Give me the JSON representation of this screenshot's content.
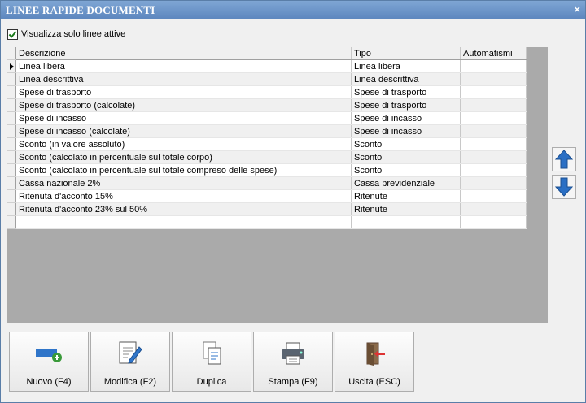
{
  "window": {
    "title": "LINEE RAPIDE DOCUMENTI",
    "close_label": "×"
  },
  "filter": {
    "checkbox_label": "Visualizza solo linee attive",
    "checked": true
  },
  "grid": {
    "columns": [
      "Descrizione",
      "Tipo",
      "Automatismi"
    ],
    "rows": [
      {
        "descrizione": "Linea libera",
        "tipo": "Linea libera",
        "automatismi": ""
      },
      {
        "descrizione": "Linea descrittiva",
        "tipo": "Linea descrittiva",
        "automatismi": ""
      },
      {
        "descrizione": "Spese di trasporto",
        "tipo": "Spese di trasporto",
        "automatismi": ""
      },
      {
        "descrizione": "Spese di trasporto (calcolate)",
        "tipo": "Spese di trasporto",
        "automatismi": ""
      },
      {
        "descrizione": "Spese di incasso",
        "tipo": "Spese di incasso",
        "automatismi": ""
      },
      {
        "descrizione": "Spese di incasso (calcolate)",
        "tipo": "Spese di incasso",
        "automatismi": ""
      },
      {
        "descrizione": "Sconto (in valore assoluto)",
        "tipo": "Sconto",
        "automatismi": ""
      },
      {
        "descrizione": "Sconto (calcolato in percentuale sul totale corpo)",
        "tipo": "Sconto",
        "automatismi": ""
      },
      {
        "descrizione": "Sconto (calcolato in percentuale sul totale compreso delle spese)",
        "tipo": "Sconto",
        "automatismi": ""
      },
      {
        "descrizione": "Cassa nazionale 2%",
        "tipo": "Cassa previdenziale",
        "automatismi": ""
      },
      {
        "descrizione": "Ritenuta d'acconto 15%",
        "tipo": "Ritenute",
        "automatismi": ""
      },
      {
        "descrizione": "Ritenuta d'acconto 23% sul 50%",
        "tipo": "Ritenute",
        "automatismi": ""
      },
      {
        "descrizione": "",
        "tipo": "",
        "automatismi": ""
      }
    ]
  },
  "side": {
    "up_icon": "arrow-up-icon",
    "down_icon": "arrow-down-icon",
    "color": "#2a6fc4"
  },
  "buttons": [
    {
      "label": "Nuovo (F4)",
      "icon": "new-icon"
    },
    {
      "label": "Modifica (F2)",
      "icon": "edit-icon"
    },
    {
      "label": "Duplica",
      "icon": "duplicate-icon"
    },
    {
      "label": "Stampa (F9)",
      "icon": "print-icon"
    },
    {
      "label": "Uscita (ESC)",
      "icon": "exit-icon"
    }
  ]
}
